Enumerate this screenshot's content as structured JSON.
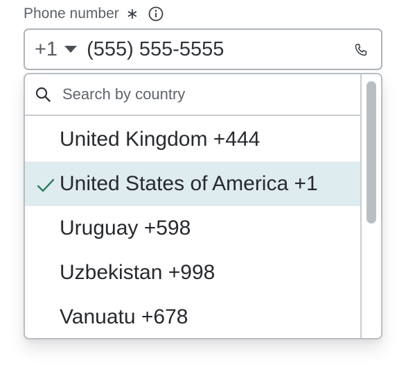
{
  "field": {
    "label": "Phone number",
    "required_mark": "∗",
    "info_icon": "info-circle-icon",
    "country_code": "+1",
    "value": "(555) 555-5555",
    "phone_icon": "phone-icon"
  },
  "dropdown": {
    "search_placeholder": "Search by country",
    "search_value": "",
    "items": [
      {
        "label": "United Kingdom +444",
        "selected": false
      },
      {
        "label": "United States of America +1",
        "selected": true
      },
      {
        "label": "Uruguay +598",
        "selected": false
      },
      {
        "label": "Uzbekistan +998",
        "selected": false
      },
      {
        "label": "Vanuatu +678",
        "selected": false
      }
    ]
  },
  "colors": {
    "selected_row_bg": "#dfecef",
    "check_color": "#2e7d5b",
    "border": "#aeb4ba"
  }
}
